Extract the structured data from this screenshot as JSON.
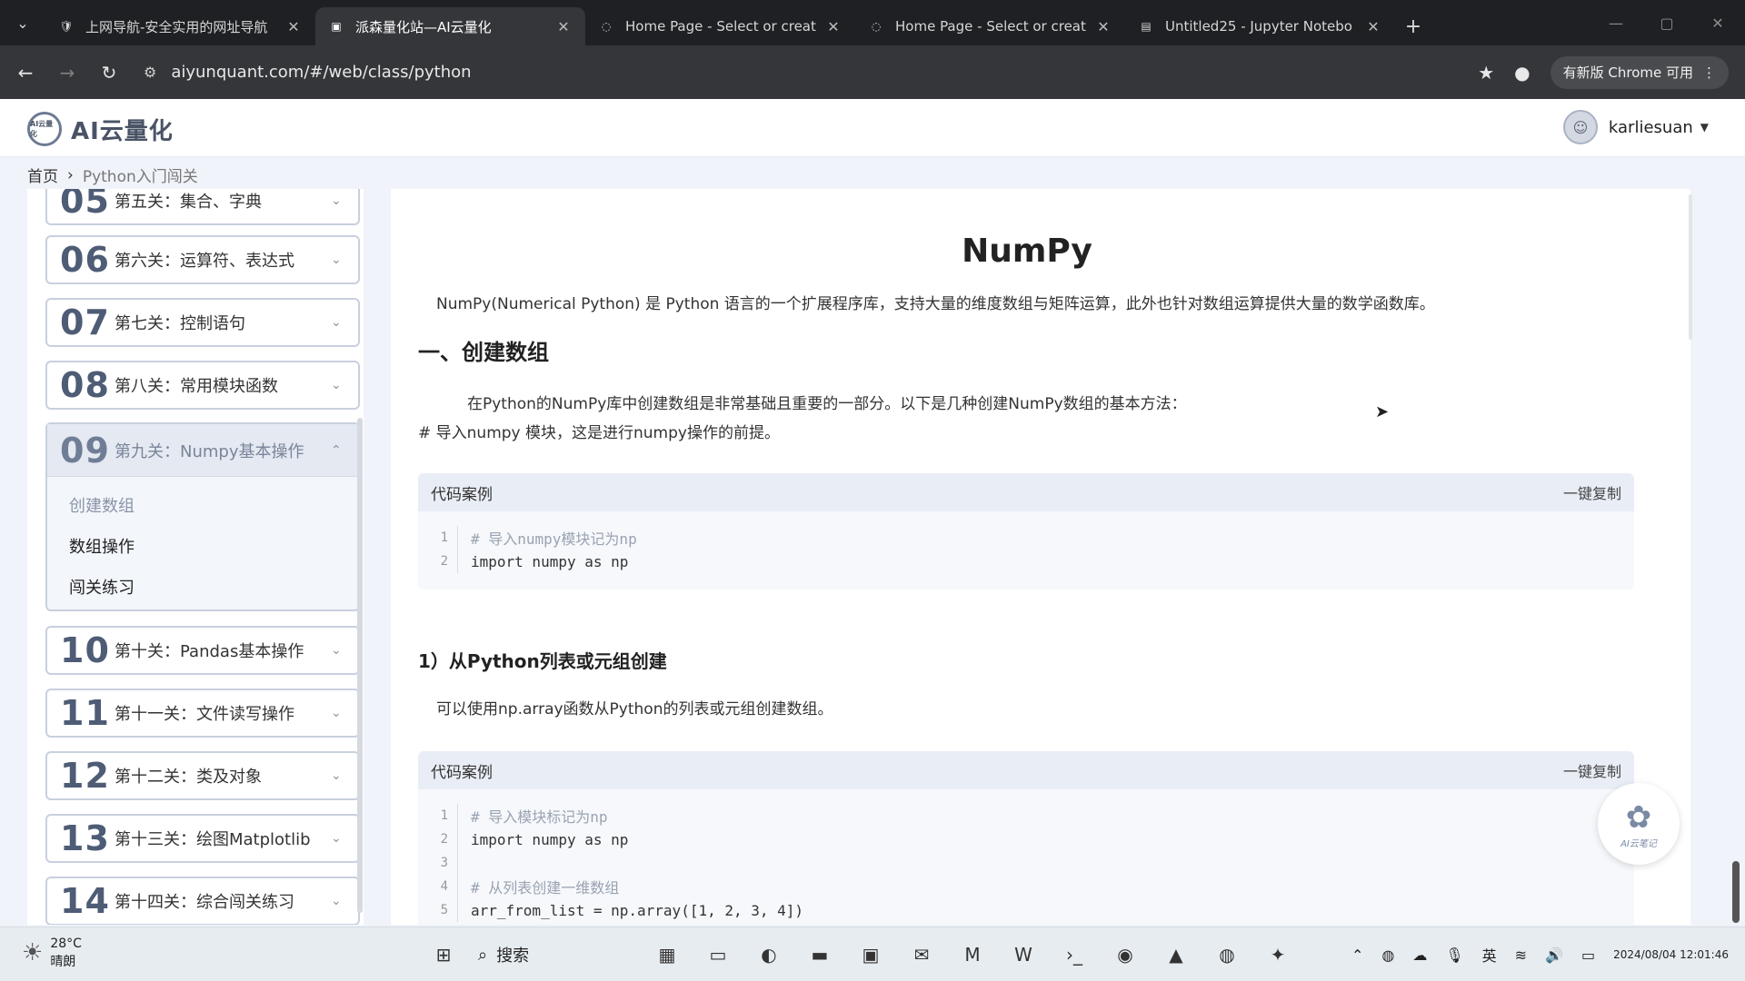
{
  "browser": {
    "tabs": [
      {
        "title": "上网导航-安全实用的网址导航",
        "active": false
      },
      {
        "title": "派森量化站—AI云量化",
        "active": true
      },
      {
        "title": "Home Page - Select or creat",
        "active": false
      },
      {
        "title": "Home Page - Select or creat",
        "active": false
      },
      {
        "title": "Untitled25 - Jupyter Notebo",
        "active": false
      }
    ],
    "url": "aiyunquant.com/#/web/class/python",
    "update_label": "有新版 Chrome 可用"
  },
  "site": {
    "logo_mark": "AI云量化",
    "logo_text": "AI云量化",
    "username": "karliesuan"
  },
  "breadcrumb": {
    "home": "首页",
    "current": "Python入门闯关"
  },
  "sidebar": {
    "lessons": [
      {
        "num": "05",
        "name": "第五关：集合、字典"
      },
      {
        "num": "06",
        "name": "第六关：运算符、表达式"
      },
      {
        "num": "07",
        "name": "第七关：控制语句"
      },
      {
        "num": "08",
        "name": "第八关：常用模块函数"
      },
      {
        "num": "09",
        "name": "第九关：Numpy基本操作"
      },
      {
        "num": "10",
        "name": "第十关：Pandas基本操作"
      },
      {
        "num": "11",
        "name": "第十一关：文件读写操作"
      },
      {
        "num": "12",
        "name": "第十二关：类及对象"
      },
      {
        "num": "13",
        "name": "第十三关：绘图Matplotlib"
      },
      {
        "num": "14",
        "name": "第十四关：综合闯关练习"
      }
    ],
    "open_subitems": [
      "创建数组",
      "数组操作",
      "闯关练习"
    ]
  },
  "doc": {
    "title": "NumPy",
    "intro": "NumPy(Numerical Python) 是 Python 语言的一个扩展程序库，支持大量的维度数组与矩阵运算，此外也针对数组运算提供大量的数学函数库。",
    "section1": "一、创建数组",
    "section1_p": "在Python的NumPy库中创建数组是非常基础且重要的一部分。以下是几种创建NumPy数组的基本方法：",
    "section1_note": "# 导入numpy 模块，这是进行numpy操作的前提。",
    "code_label": "代码案例",
    "copy_label": "一键复制",
    "code1": [
      "# 导入numpy模块记为np",
      "import numpy as np"
    ],
    "sub1": "1）从Python列表或元组创建",
    "sub1_p": "可以使用np.array函数从Python的列表或元组创建数组。",
    "code2": [
      "# 导入模块标记为np",
      "import numpy as np",
      "",
      "# 从列表创建一维数组",
      "arr_from_list = np.array([1, 2, 3, 4])"
    ],
    "badge": "AI云笔记"
  },
  "taskbar": {
    "temp": "28°C",
    "weather": "晴朗",
    "search": "搜索",
    "ime": "英",
    "date": "2024/08/04 12:01:46"
  }
}
